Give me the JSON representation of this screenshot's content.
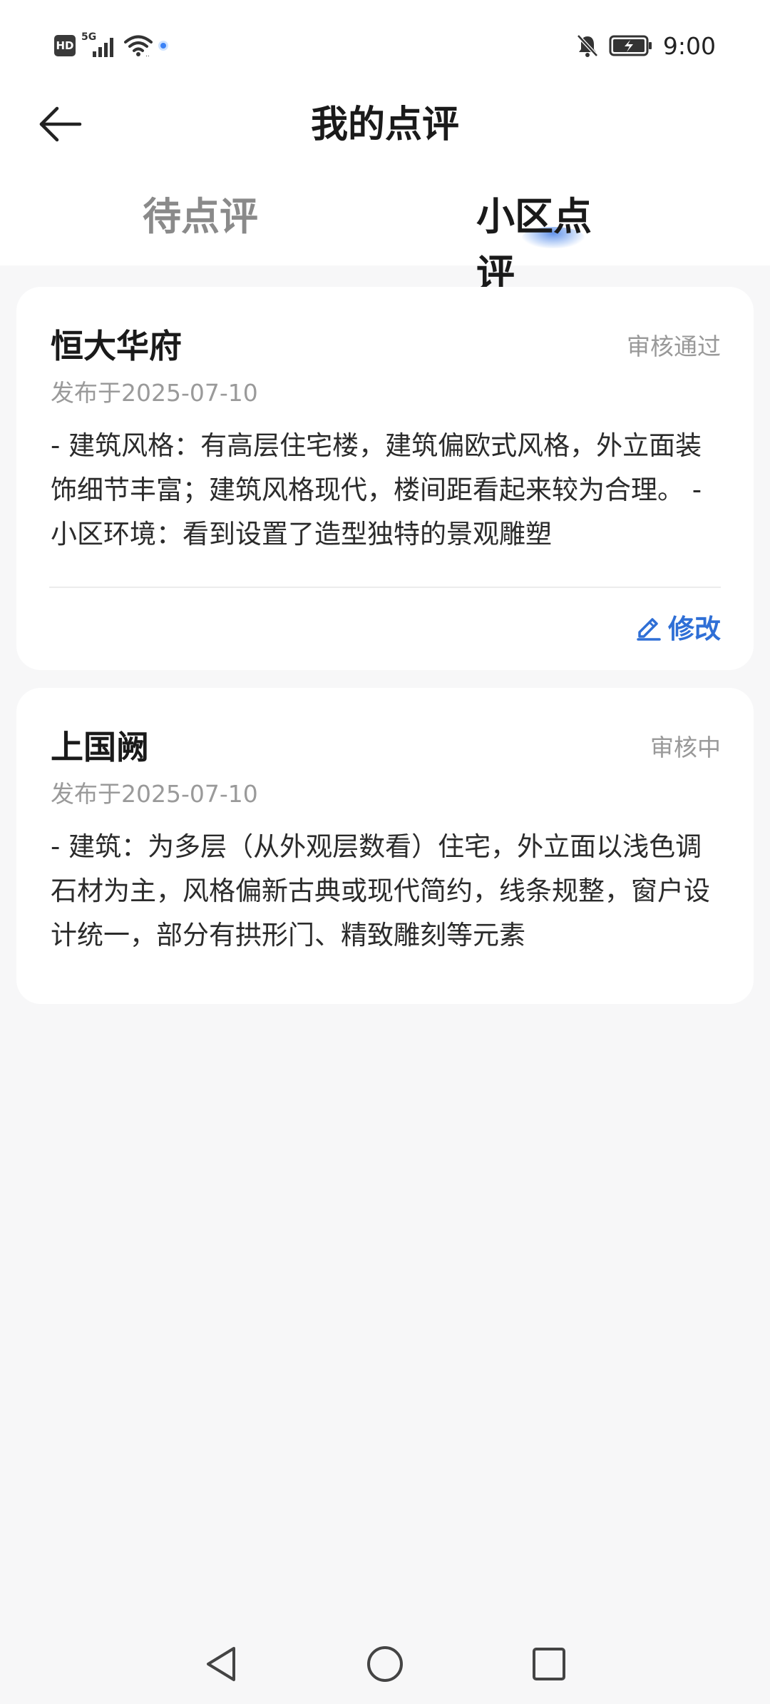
{
  "status_bar": {
    "hd_label": "HD",
    "network_label": "5G",
    "time": "9:00",
    "icons": [
      "hd-icon",
      "signal-icon",
      "wifi-icon",
      "location-dot-icon",
      "mute-bell-icon",
      "battery-icon"
    ]
  },
  "header": {
    "title": "我的点评",
    "back_icon": "arrow-left-icon"
  },
  "tabs": [
    {
      "label": "待点评",
      "active": false
    },
    {
      "label": "小区点评",
      "active": true
    }
  ],
  "reviews": [
    {
      "name": "恒大华府",
      "status": "审核通过",
      "date": "发布于2025-07-10",
      "content": " - 建筑风格：有高层住宅楼，建筑偏欧式风格，外立面装饰细节丰富；建筑风格现代，楼间距看起来较为合理。 - 小区环境：看到设置了造型独特的景观雕塑",
      "edit_label": "修改",
      "edit_icon": "pencil-icon"
    },
    {
      "name": "上国阙",
      "status": "审核中",
      "date": "发布于2025-07-10",
      "content": " - 建筑：为多层（从外观层数看）住宅，外立面以浅色调石材为主，风格偏新古典或现代简约，线条规整，窗户设计统一，部分有拱形门、精致雕刻等元素"
    }
  ],
  "nav_bar": {
    "icons": [
      "nav-back-icon",
      "nav-home-icon",
      "nav-recent-icon"
    ]
  },
  "colors": {
    "accent": "#2f6fd6",
    "background": "#f7f7f8",
    "card": "#ffffff",
    "muted_text": "#999999"
  }
}
